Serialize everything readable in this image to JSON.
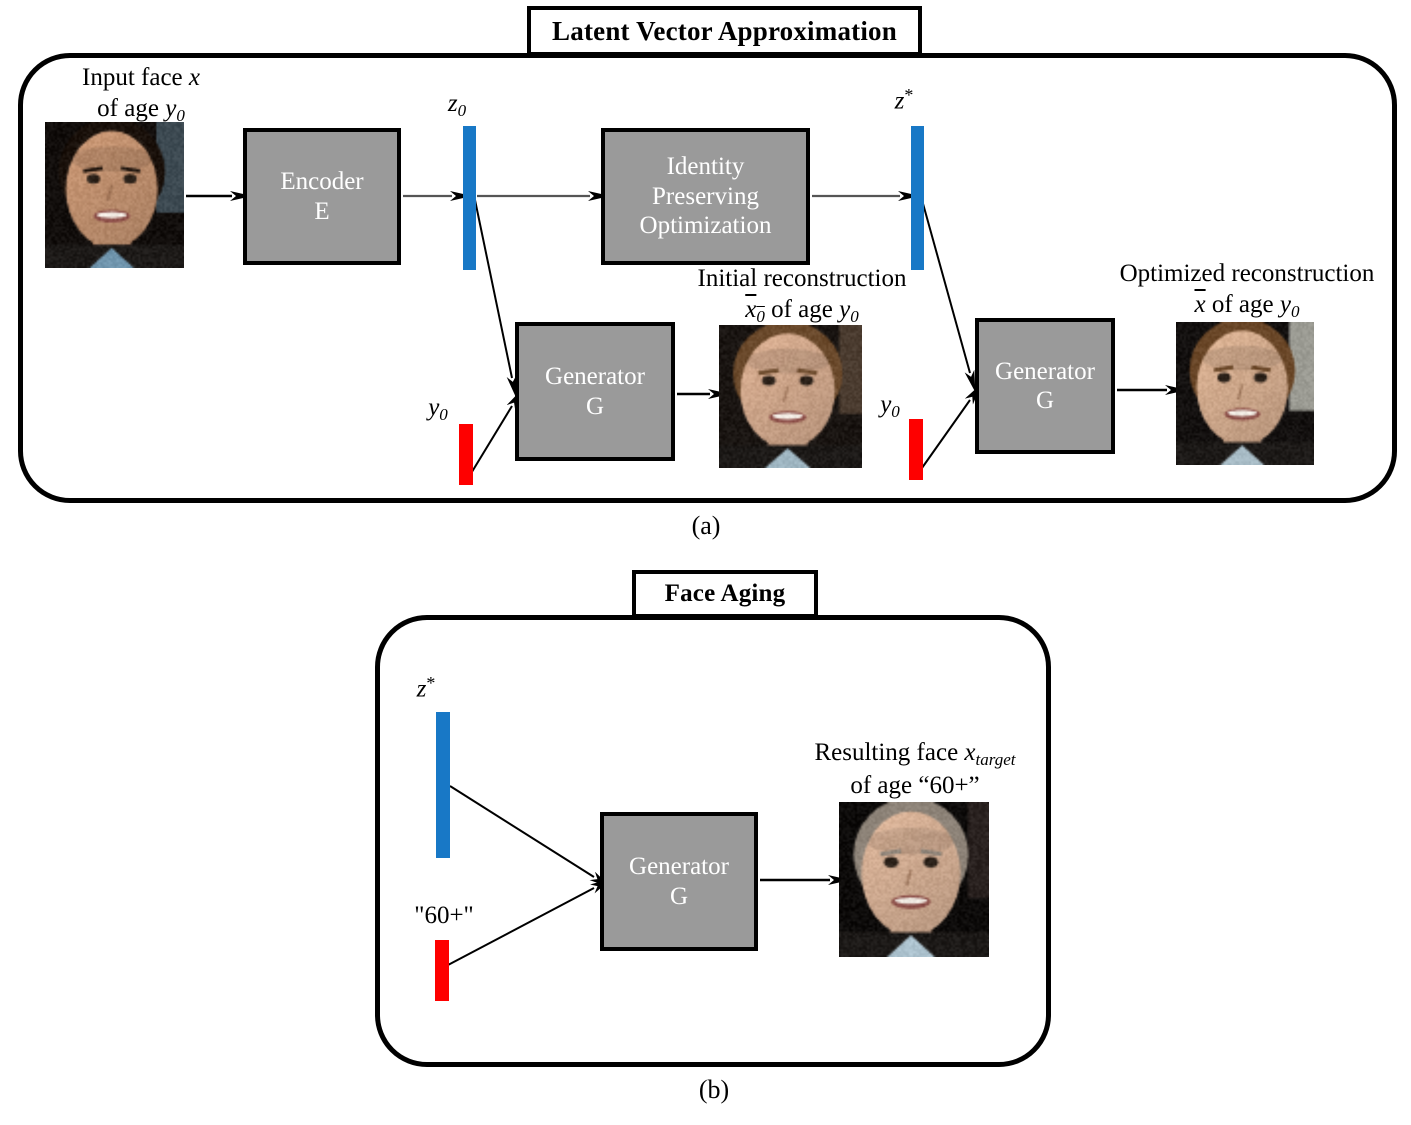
{
  "figure": {
    "panels": [
      {
        "id": "a",
        "title": "Latent Vector Approximation",
        "caption": "(a)",
        "elements": {
          "input_label_line1": "Input face x",
          "input_label_line2": "of age y0",
          "encoder_line1": "Encoder",
          "encoder_line2": "E",
          "z0_label": "z0",
          "ipo_line1": "Identity",
          "ipo_line2": "Preserving",
          "ipo_line3": "Optimization",
          "zstar_label": "z*",
          "generator1_line1": "Generator",
          "generator1_line2": "G",
          "generator2_line1": "Generator",
          "generator2_line2": "G",
          "y0_label_1": "y0",
          "y0_label_2": "y0",
          "initial_rec_line1": "Initial reconstruction",
          "initial_rec_line2": "x0 of age y0",
          "optimized_rec_line1": "Optimized reconstruction",
          "optimized_rec_line2": "x of age y0"
        }
      },
      {
        "id": "b",
        "title": "Face Aging",
        "caption": "(b)",
        "elements": {
          "zstar_label": "z*",
          "age_label": "\"60+\"",
          "generator_line1": "Generator",
          "generator_line2": "G",
          "result_line1": "Resulting face xtarget",
          "result_line2": "of age \"60+\""
        }
      }
    ],
    "colors": {
      "latent_bar": "#1878c6",
      "condition_bar": "#fe0000",
      "process_box": "#9a9a9a",
      "outline": "#000000",
      "box_text": "#ffffff",
      "background": "#ffffff"
    },
    "icons": {
      "input_face_photo": "face-photo-young-man-input",
      "initial_reconstruction_photo": "face-photo-initial-reconstruction",
      "optimized_reconstruction_photo": "face-photo-optimized-reconstruction",
      "aged_result_photo": "face-photo-aged-60plus"
    }
  }
}
